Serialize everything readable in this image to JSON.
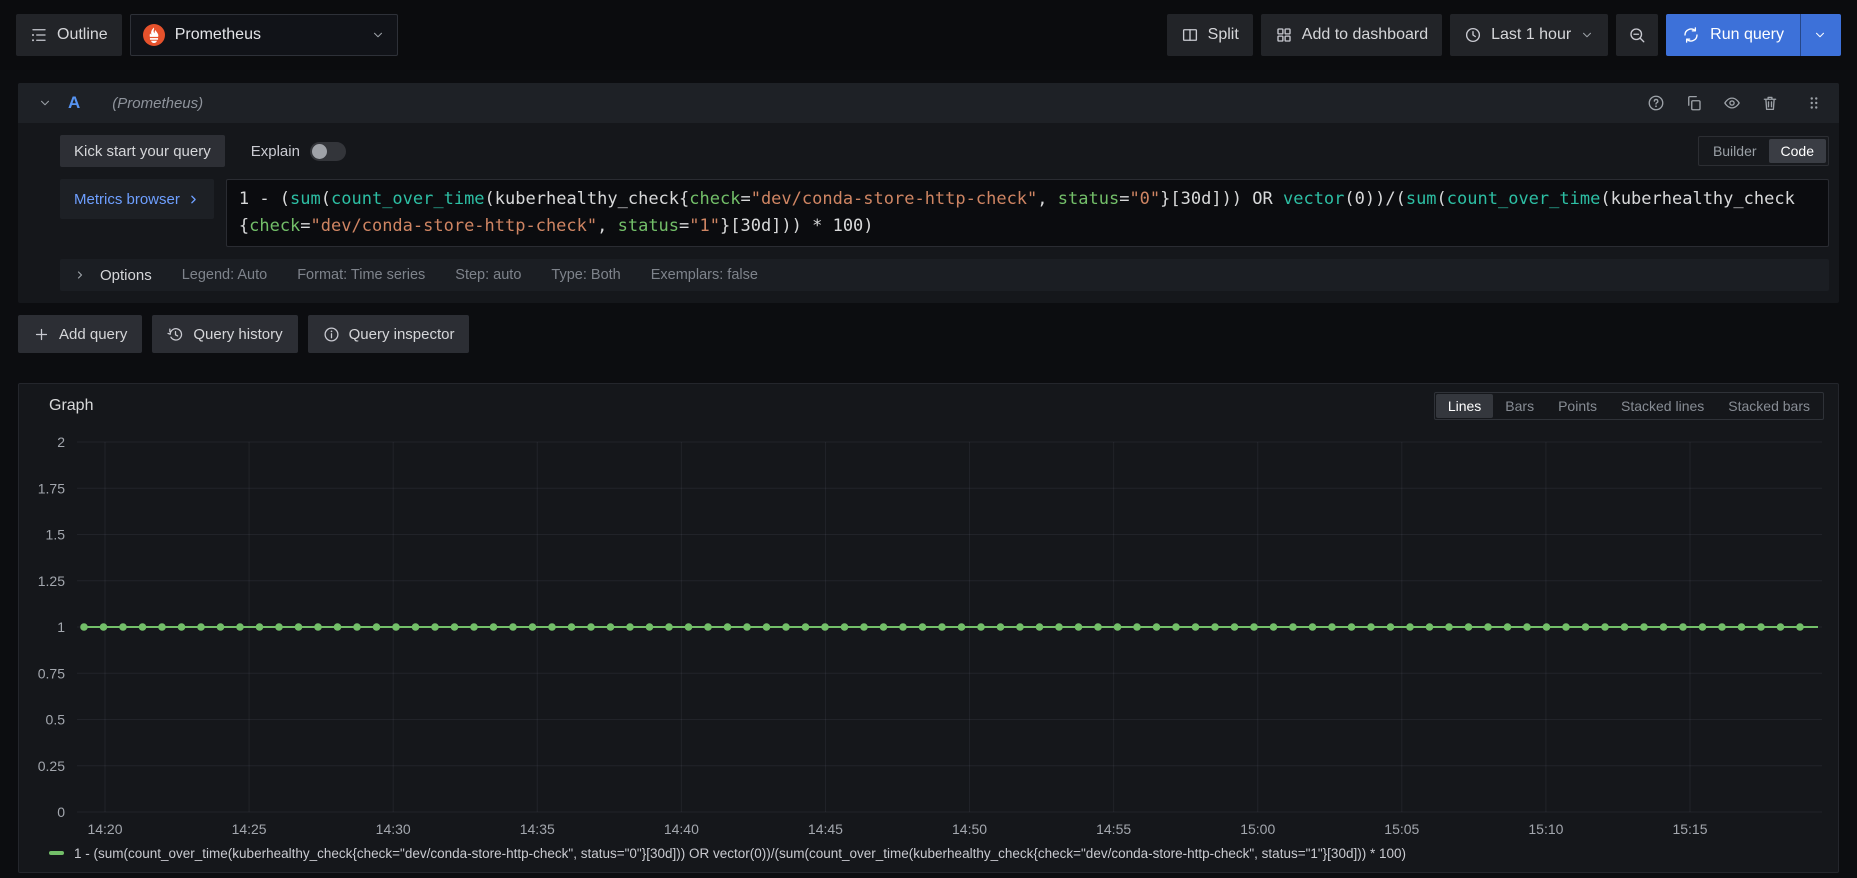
{
  "colors": {
    "accent_blue": "#3d71d9",
    "refid_blue": "#5794f2",
    "link_blue": "#6e9fff",
    "series_green": "#73bf69",
    "prometheus_orange": "#e6522c",
    "code_function": "#2dbfa4",
    "code_label": "#73bf69",
    "code_string": "#cf8563"
  },
  "icons": [
    "outline-icon",
    "prometheus-logo-icon",
    "chevron-down-icon",
    "split-icon",
    "apps-grid-icon",
    "clock-icon",
    "zoom-out-icon",
    "sync-icon",
    "help-circle-icon",
    "copy-icon",
    "eye-icon",
    "trash-icon",
    "drag-handle-icon",
    "chevron-right-icon",
    "plus-icon",
    "history-icon",
    "info-circle-icon"
  ],
  "topbar": {
    "outline_label": "Outline",
    "datasource_name": "Prometheus",
    "split_label": "Split",
    "add_to_dashboard_label": "Add to dashboard",
    "time_range_label": "Last 1 hour",
    "run_query_label": "Run query"
  },
  "query_editor": {
    "ref_id": "A",
    "datasource_hint": "(Prometheus)",
    "kick_start_label": "Kick start your query",
    "explain_label": "Explain",
    "explain_enabled": false,
    "builder_label": "Builder",
    "code_label": "Code",
    "editor_mode": "Code",
    "metrics_browser_label": "Metrics browser",
    "code_lines": [
      [
        {
          "t": "1 - (",
          "c": "plain"
        },
        {
          "t": "sum",
          "c": "fn"
        },
        {
          "t": "(",
          "c": "plain"
        },
        {
          "t": "count_over_time",
          "c": "fn"
        },
        {
          "t": "(",
          "c": "plain"
        },
        {
          "t": "kuberhealthy_check{",
          "c": "plain"
        },
        {
          "t": "check",
          "c": "label"
        },
        {
          "t": "=",
          "c": "plain"
        },
        {
          "t": "\"dev/conda-store-http-check\"",
          "c": "string"
        },
        {
          "t": ", ",
          "c": "plain"
        },
        {
          "t": "status",
          "c": "label"
        },
        {
          "t": "=",
          "c": "plain"
        },
        {
          "t": "\"0\"",
          "c": "string"
        },
        {
          "t": "}[30d])) OR ",
          "c": "plain"
        },
        {
          "t": "vector",
          "c": "fn"
        },
        {
          "t": "(0))/(",
          "c": "plain"
        },
        {
          "t": "sum",
          "c": "fn"
        },
        {
          "t": "(",
          "c": "plain"
        },
        {
          "t": "count_over_time",
          "c": "fn"
        },
        {
          "t": "(",
          "c": "plain"
        },
        {
          "t": "kuberhealthy_check",
          "c": "plain"
        }
      ],
      [
        {
          "t": "{",
          "c": "plain"
        },
        {
          "t": "check",
          "c": "label"
        },
        {
          "t": "=",
          "c": "plain"
        },
        {
          "t": "\"dev/conda-store-http-check\"",
          "c": "string"
        },
        {
          "t": ", ",
          "c": "plain"
        },
        {
          "t": "status",
          "c": "label"
        },
        {
          "t": "=",
          "c": "plain"
        },
        {
          "t": "\"1\"",
          "c": "string"
        },
        {
          "t": "}[30d])) * 100)",
          "c": "plain"
        }
      ]
    ],
    "options": {
      "label": "Options",
      "items": [
        "Legend: Auto",
        "Format: Time series",
        "Step: auto",
        "Type: Both",
        "Exemplars: false"
      ]
    }
  },
  "query_actions": {
    "add_query_label": "Add query",
    "query_history_label": "Query history",
    "query_inspector_label": "Query inspector"
  },
  "graph": {
    "title": "Graph",
    "style_options": [
      "Lines",
      "Bars",
      "Points",
      "Stacked lines",
      "Stacked bars"
    ],
    "active_style": "Lines",
    "legend_text": "1 - (sum(count_over_time(kuberhealthy_check{check=\"dev/conda-store-http-check\", status=\"0\"}[30d])) OR vector(0))/(sum(count_over_time(kuberhealthy_check{check=\"dev/conda-store-http-check\", status=\"1\"}[30d])) * 100)"
  },
  "chart_data": {
    "type": "line",
    "title": "Graph",
    "xlabel": "",
    "ylabel": "",
    "x_ticks": [
      "14:20",
      "14:25",
      "14:30",
      "14:35",
      "14:40",
      "14:45",
      "14:50",
      "14:55",
      "15:00",
      "15:05",
      "15:10",
      "15:15"
    ],
    "y_ticks": [
      "2",
      "1.75",
      "1.5",
      "1.25",
      "1",
      "0.75",
      "0.5",
      "0.25",
      "0"
    ],
    "ylim": [
      0,
      2
    ],
    "grid": true,
    "legend_position": "bottom",
    "series": [
      {
        "name": "1 - (sum(count_over_time(kuberhealthy_check{check=\"dev/conda-store-http-check\", status=\"0\"}[30d])) OR vector(0))/(sum(count_over_time(kuberhealthy_check{check=\"dev/conda-store-http-check\", status=\"1\"}[30d])) * 100)",
        "color": "#73bf69",
        "style": "line+points",
        "constant_value": 1,
        "values": [
          1,
          1,
          1,
          1,
          1,
          1,
          1,
          1,
          1,
          1,
          1,
          1
        ]
      }
    ]
  }
}
